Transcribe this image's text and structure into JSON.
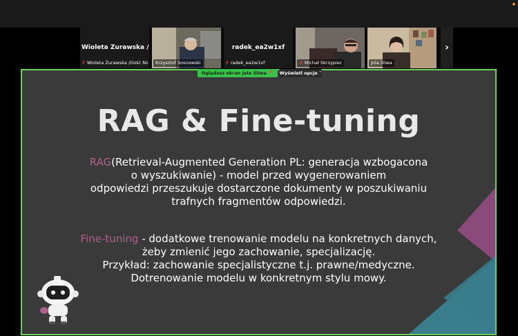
{
  "participants": [
    {
      "big_name": "Wioleta Żurawska /Goś...",
      "caption": "Wioleta Żurawska /Gość Nied...",
      "muted": true,
      "video": false
    },
    {
      "big_name": "",
      "caption": "Krzysztof Sosnowski",
      "muted": false,
      "video": true
    },
    {
      "big_name": "radek_ea2w1xf",
      "caption": "radek_ea2w1xf",
      "muted": true,
      "video": false
    },
    {
      "big_name": "",
      "caption": "Michał Skrzypiec",
      "muted": true,
      "video": true
    },
    {
      "big_name": "",
      "caption": "Jola Śliwa",
      "muted": false,
      "video": true
    }
  ],
  "share_banner": "Oglądasz ekran  Jola Śliwa",
  "view_options": "Wyświetl opcje ˅",
  "slide": {
    "title": "RAG & Fine-tuning",
    "rag": {
      "term": "RAG",
      "lines": [
        "(Retrieval-Augmented Generation PL: generacja wzbogacona",
        "o wyszukiwanie) - model przed wygenerowaniem",
        "odpowiedzi przeszukuje dostarczone dokumenty w poszukiwaniu",
        "trafnych fragmentów odpowiedzi."
      ]
    },
    "ft": {
      "term": "Fine-tuning",
      "lines": [
        " - dodatkowe trenowanie modelu na konkretnych danych,",
        "żeby zmienić jego zachowanie, specjalizację.",
        "Przykład: zachowanie specjalistyczne t.j. prawne/medyczne.",
        "Dotrenowanie modelu w konkretnym stylu mowy."
      ]
    }
  },
  "colors": {
    "accent": "#b0608a",
    "teal": "#3a7d8c",
    "purple": "#8a4a7a",
    "active_border": "#6ad35a"
  },
  "icons": {
    "next": "chevron-right-icon",
    "mic": "mic-muted-icon"
  }
}
